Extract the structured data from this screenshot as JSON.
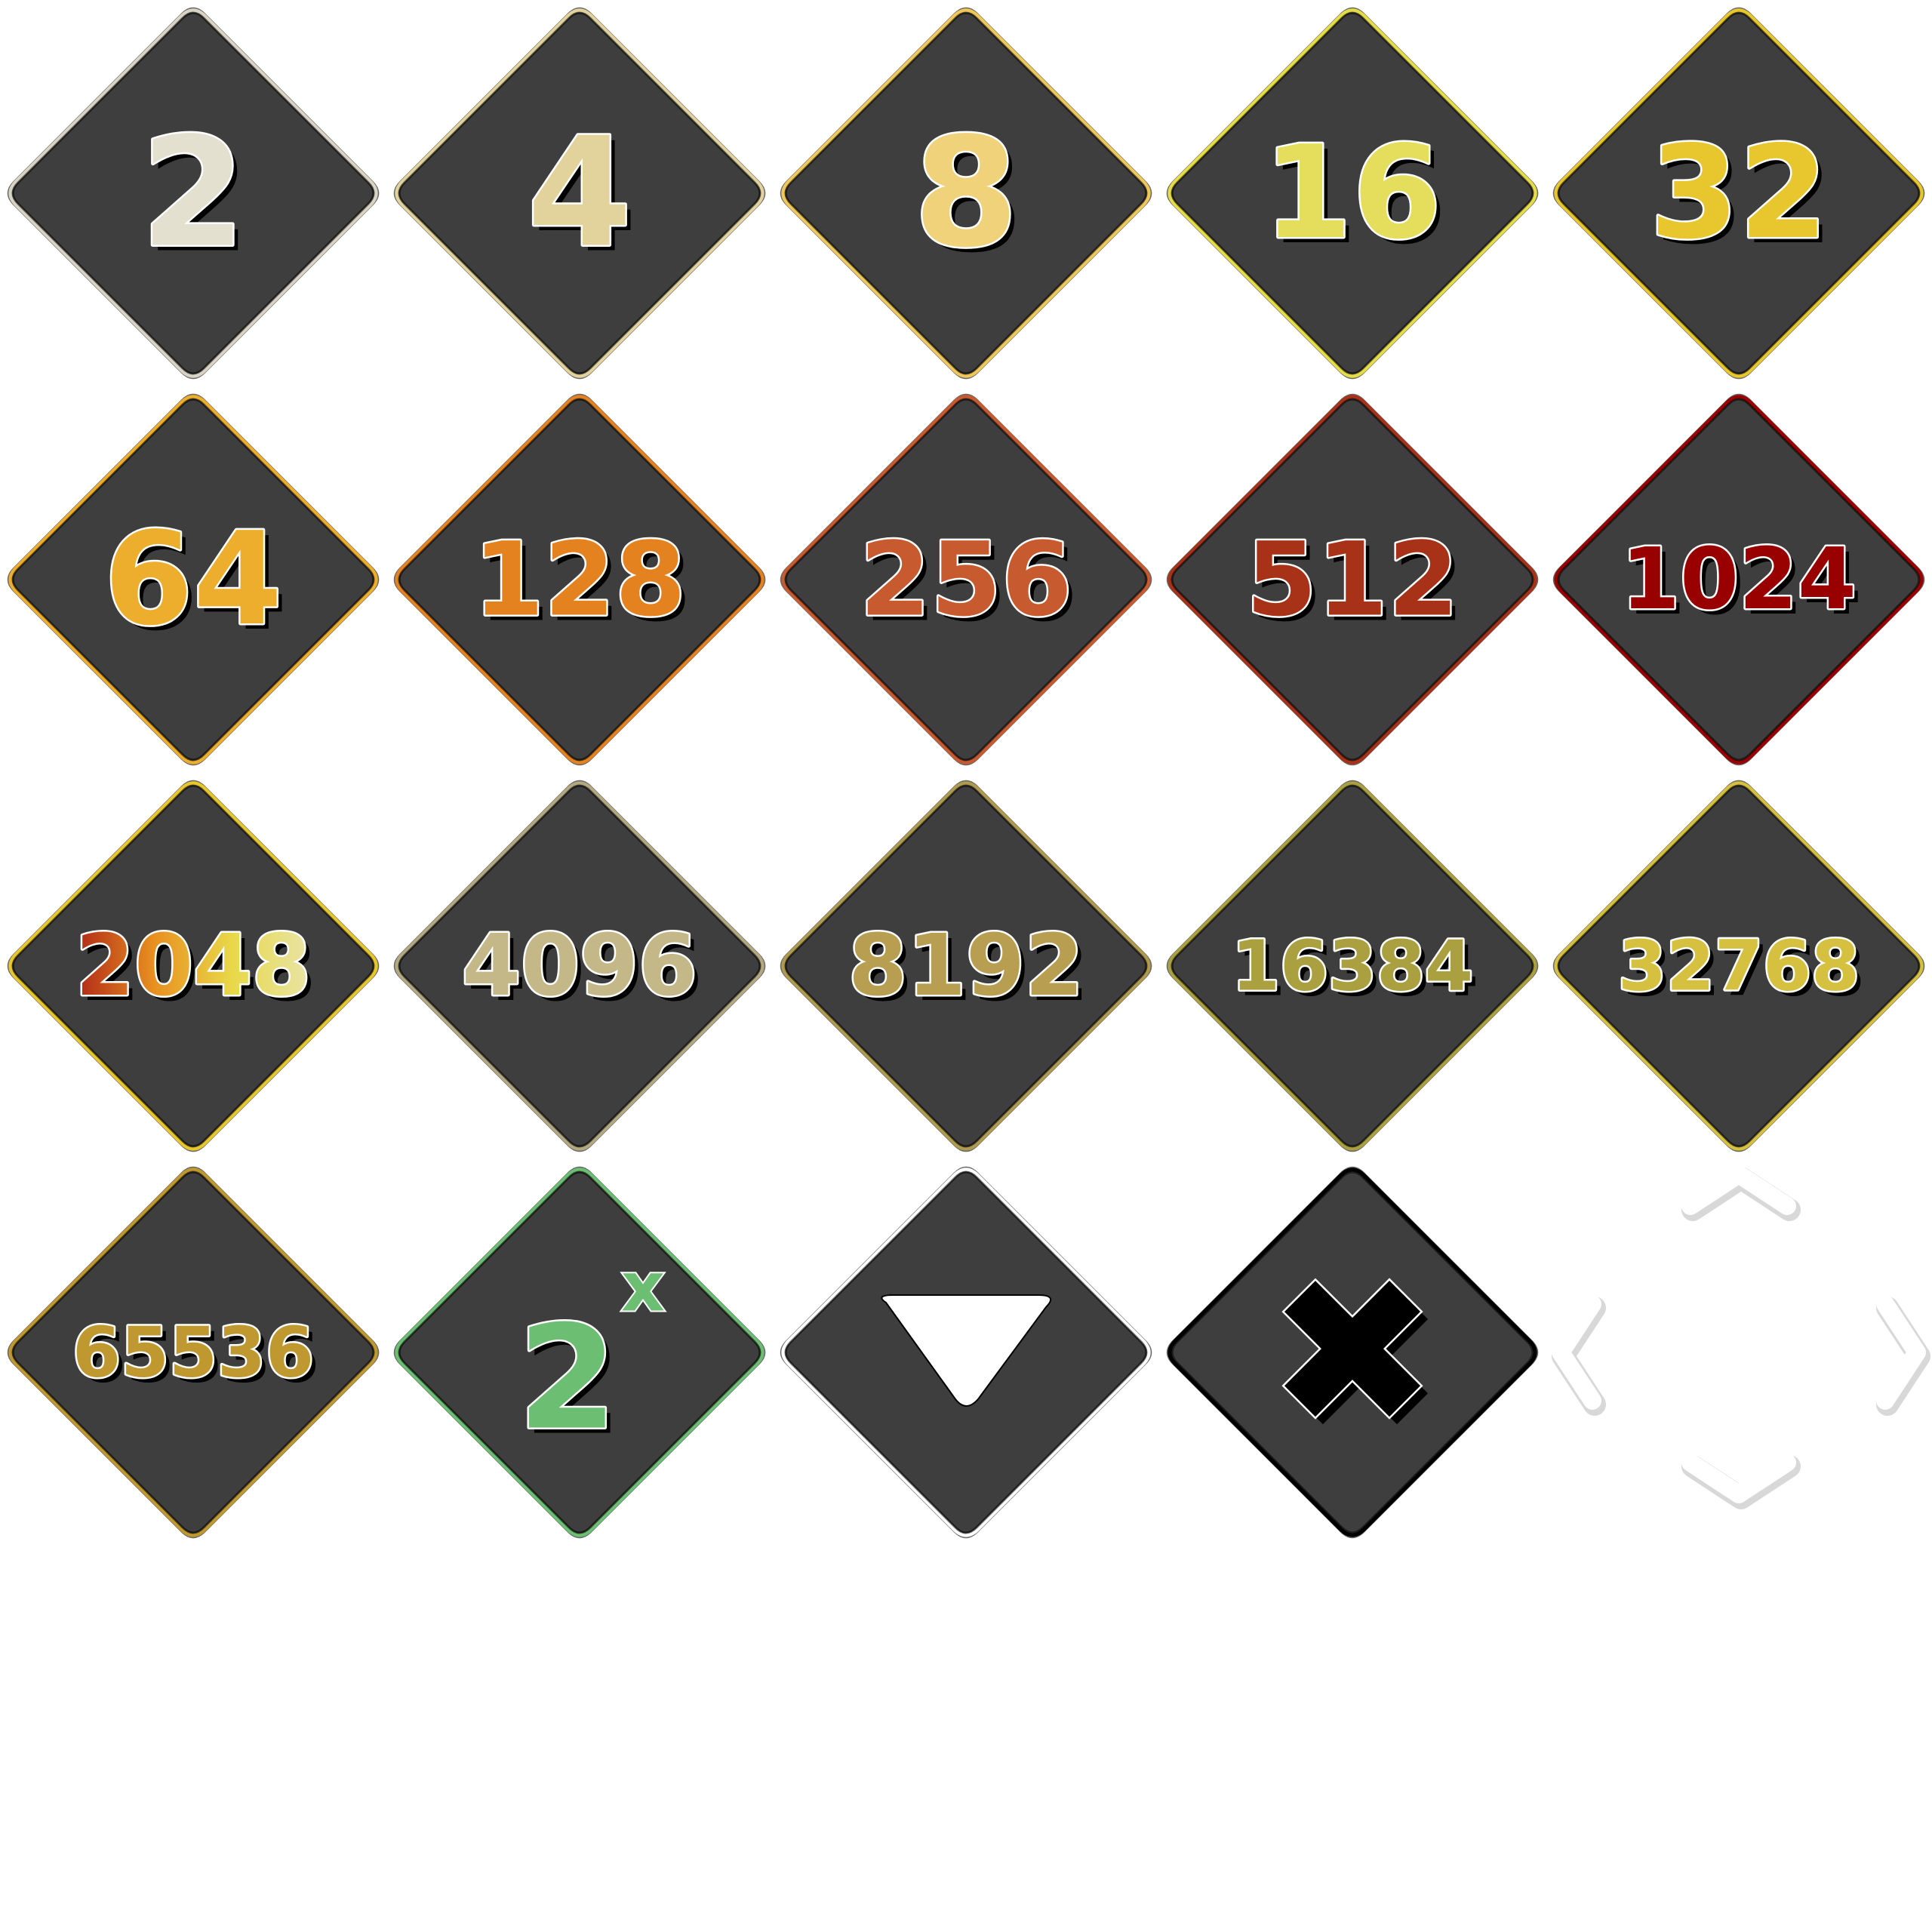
{
  "tiles": [
    {
      "id": "tile-2",
      "kind": "number",
      "label": "2",
      "color": "#e4e0cf",
      "border": "#d8d4c4"
    },
    {
      "id": "tile-4",
      "kind": "number",
      "label": "4",
      "color": "#e2d39d",
      "border": "#e2d39d"
    },
    {
      "id": "tile-8",
      "kind": "number",
      "label": "8",
      "color": "#f0d27a",
      "border": "#f0c85a"
    },
    {
      "id": "tile-16",
      "kind": "number",
      "label": "16",
      "color": "#e4de5c",
      "border": "#e6dc4a"
    },
    {
      "id": "tile-32",
      "kind": "number",
      "label": "32",
      "color": "#e8c62e",
      "border": "#e8c62e"
    },
    {
      "id": "tile-64",
      "kind": "number",
      "label": "64",
      "color": "#edae2e",
      "border": "#edae2e"
    },
    {
      "id": "tile-128",
      "kind": "number",
      "label": "128",
      "color": "#e58220",
      "border": "#e58220"
    },
    {
      "id": "tile-256",
      "kind": "number",
      "label": "256",
      "color": "#c85a30",
      "border": "#c85a30"
    },
    {
      "id": "tile-512",
      "kind": "number",
      "label": "512",
      "color": "#a83218",
      "border": "#a83218"
    },
    {
      "id": "tile-1024",
      "kind": "number",
      "label": "1024",
      "color": "#990000",
      "border": "#990000"
    },
    {
      "id": "tile-2048",
      "kind": "number",
      "label": "2048",
      "color": "gradient",
      "gradient": [
        "#b02818",
        "#e89020",
        "#e8d848",
        "#e8e4a8"
      ],
      "border": "#e8c62e"
    },
    {
      "id": "tile-4096",
      "kind": "number",
      "label": "4096",
      "color": "#c4b888",
      "border": "#b4a880"
    },
    {
      "id": "tile-8192",
      "kind": "number",
      "label": "8192",
      "color": "#b89e50",
      "border": "#b09a50"
    },
    {
      "id": "tile-16384",
      "kind": "number",
      "label": "16384",
      "color": "#aaa040",
      "border": "#aaa040"
    },
    {
      "id": "tile-32768",
      "kind": "number",
      "label": "32768",
      "color": "#d6c040",
      "border": "#d6c040"
    },
    {
      "id": "tile-65536",
      "kind": "number",
      "label": "65536",
      "color": "#c09830",
      "border": "#c09830"
    },
    {
      "id": "tile-powerup-2x",
      "kind": "power",
      "label": "2",
      "superscript": "x",
      "color": "#6cbe72",
      "border": "#6cbe72"
    },
    {
      "id": "tile-arrow-down",
      "kind": "triangle-icon",
      "color": "#ffffff",
      "border": "#ffffff"
    },
    {
      "id": "tile-blocker-x",
      "kind": "x-icon",
      "color": "#000000",
      "border": "#000000"
    },
    {
      "id": "tile-direction-cursor",
      "kind": "chevrons",
      "color": "#ffffff"
    }
  ]
}
